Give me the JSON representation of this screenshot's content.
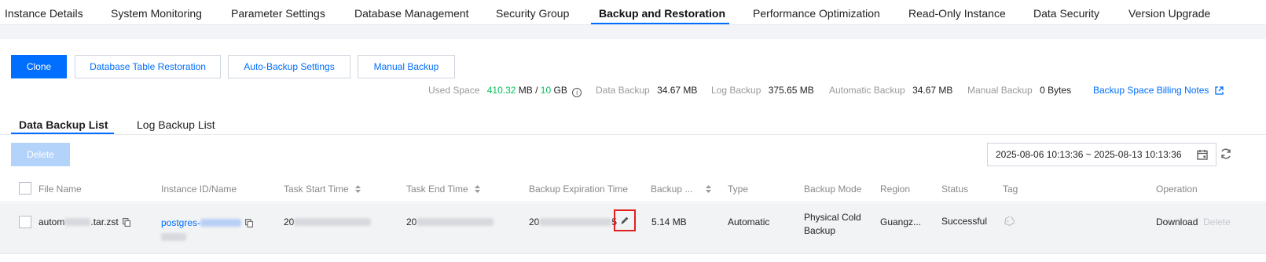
{
  "nav": {
    "tabs": [
      {
        "label": "Instance Details"
      },
      {
        "label": "System Monitoring"
      },
      {
        "label": "Parameter Settings"
      },
      {
        "label": "Database Management"
      },
      {
        "label": "Security Group"
      },
      {
        "label": "Backup and Restoration",
        "active": true
      },
      {
        "label": "Performance Optimization"
      },
      {
        "label": "Read-Only Instance"
      },
      {
        "label": "Data Security"
      },
      {
        "label": "Version Upgrade"
      }
    ]
  },
  "toolbar": {
    "clone": "Clone",
    "table_restore": "Database Table Restoration",
    "auto_backup": "Auto-Backup Settings",
    "manual_backup": "Manual Backup"
  },
  "stats": {
    "used_space_label": "Used Space",
    "used_value": "410.32",
    "used_unit": "MB",
    "slash": "/",
    "total_value": "10",
    "total_unit": "GB",
    "data_backup_label": "Data Backup",
    "data_backup_value": "34.67 MB",
    "log_backup_label": "Log Backup",
    "log_backup_value": "375.65 MB",
    "auto_backup_label": "Automatic Backup",
    "auto_backup_value": "34.67 MB",
    "manual_backup_label": "Manual Backup",
    "manual_backup_value": "0 Bytes",
    "billing_link": "Backup Space Billing Notes"
  },
  "subtabs": {
    "data_list": "Data Backup List",
    "log_list": "Log Backup List"
  },
  "actions": {
    "delete": "Delete"
  },
  "date_range": {
    "value": "2025-08-06 10:13:36  ~ 2025-08-13 10:13:36"
  },
  "table": {
    "columns": {
      "file_name": "File Name",
      "instance": "Instance ID/Name",
      "start": "Task Start Time",
      "end": "Task End Time",
      "expire": "Backup Expiration Time",
      "size": "Backup ...",
      "type": "Type",
      "mode": "Backup Mode",
      "region": "Region",
      "status": "Status",
      "tag": "Tag",
      "operation": "Operation"
    },
    "row": {
      "file_prefix": "autom",
      "file_suffix": ".tar.zst",
      "instance_prefix": "postgres-",
      "start_prefix": "20",
      "end_prefix": "20",
      "expire_prefix": "20",
      "expire_suffix": "5",
      "size": "5.14 MB",
      "type": "Automatic",
      "mode_line1": "Physical Cold",
      "mode_line2": "Backup",
      "region": "Guangz...",
      "status": "Successful",
      "status_color": "#0abf5b",
      "download": "Download",
      "delete": "Delete"
    }
  },
  "colors": {
    "accent": "#006eff",
    "success": "#0abf5b",
    "highlight_border": "#e02020"
  }
}
